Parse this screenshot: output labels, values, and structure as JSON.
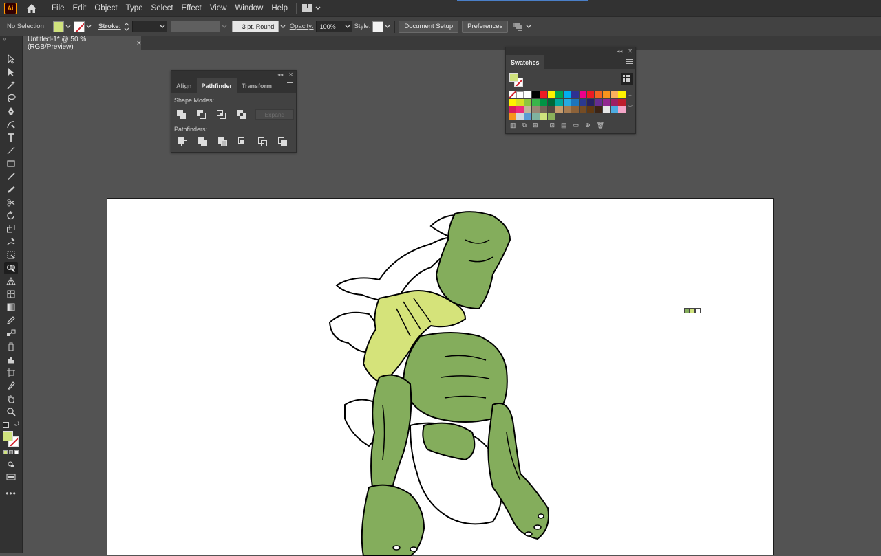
{
  "app": {
    "logo_text": "Ai"
  },
  "menu": {
    "items": [
      "File",
      "Edit",
      "Object",
      "Type",
      "Select",
      "Effect",
      "View",
      "Window",
      "Help"
    ]
  },
  "control": {
    "selection_label": "No Selection",
    "stroke_label": "Stroke:",
    "brush_value": "3 pt. Round",
    "opacity_label": "Opacity:",
    "opacity_value": "100%",
    "style_label": "Style:",
    "doc_setup_label": "Document Setup",
    "preferences_label": "Preferences"
  },
  "document": {
    "tab_title": "Untitled-1* @ 50 % (RGB/Preview)",
    "close_glyph": "×"
  },
  "pathfinder_panel": {
    "tabs": [
      "Align",
      "Pathfinder",
      "Transform"
    ],
    "active_tab": "Pathfinder",
    "shape_modes_label": "Shape Modes:",
    "expand_label": "Expand",
    "pathfinders_label": "Pathfinders:"
  },
  "swatches_panel": {
    "title": "Swatches",
    "colors": {
      "row1": [
        "none",
        "reg",
        "#ffffff",
        "#000000",
        "#ed1c24",
        "#fff200",
        "#00a651",
        "#00aeef",
        "#2e3192",
        "#ec008c",
        "#ed1c24",
        "#f26522",
        "#f7941d",
        "#fbaf5d",
        "#fff200"
      ],
      "row2": [
        "#fff200",
        "#d7df23",
        "#8dc63f",
        "#39b54a",
        "#009444",
        "#006838",
        "#00a99d",
        "#27aae1",
        "#1c75bc",
        "#2b3990",
        "#262262",
        "#662d91",
        "#92278f",
        "#9e1f63",
        "#be1e2d"
      ],
      "row3": [
        "#da1c5c",
        "#ee2a7b",
        "#c2b59b",
        "#998675",
        "#736357",
        "#534741",
        "#c69c6d",
        "#a67c52",
        "#8c6239",
        "#754c24",
        "#603913",
        "#3c2415",
        "#e6e6e6",
        "#4dabe0",
        "#f4a6c8"
      ],
      "row4": [
        "#f7941d",
        "#d0d8e0",
        "#5b9bd5",
        "#7fb2a0",
        "#cfe27d",
        "#8bb15a"
      ]
    }
  },
  "colors": {
    "fill": "#cfe27d",
    "body_green": "#84ad5c",
    "fur_yellow": "#d5e37a",
    "accent_blue": "#3d8fd6"
  },
  "icons": [
    "home-icon",
    "selection-tool-icon",
    "direct-selection-icon",
    "magic-wand-icon",
    "lasso-icon",
    "pen-icon",
    "curvature-icon",
    "type-icon",
    "line-icon",
    "rectangle-icon",
    "paintbrush-icon",
    "pencil-icon",
    "scissors-icon",
    "rotate-icon",
    "scale-icon",
    "warp-icon",
    "free-transform-icon",
    "shape-builder-icon",
    "perspective-icon",
    "mesh-icon",
    "gradient-icon",
    "eyedropper-icon",
    "blend-icon",
    "symbol-sprayer-icon",
    "column-graph-icon",
    "artboard-icon",
    "slice-icon",
    "hand-icon",
    "zoom-icon"
  ]
}
